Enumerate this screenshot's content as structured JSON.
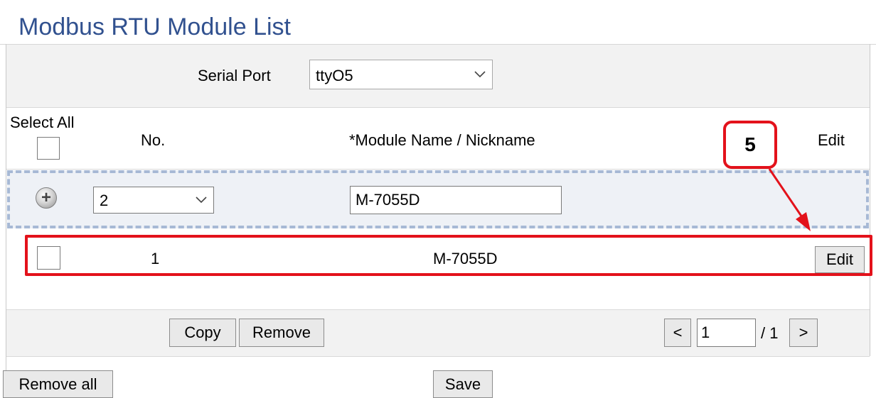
{
  "page": {
    "title": "Modbus RTU Module List"
  },
  "serial_port": {
    "label": "Serial Port",
    "selected": "ttyO5"
  },
  "table_header": {
    "select_all": "Select All",
    "no": "No.",
    "module_name": "*Module Name / Nickname",
    "edit": "Edit"
  },
  "add_row": {
    "no_selected": "2",
    "name_value": "M-7055D"
  },
  "rows": [
    {
      "no": "1",
      "name": "M-7055D",
      "edit_label": "Edit"
    }
  ],
  "actions": {
    "copy": "Copy",
    "remove": "Remove",
    "remove_all": "Remove all",
    "save": "Save"
  },
  "pager": {
    "prev": "<",
    "next": ">",
    "current": "1",
    "total": "/ 1"
  },
  "annotation": {
    "label": "5",
    "color": "#e3121b"
  },
  "colors": {
    "title": "#31518f",
    "highlight": "#e3121b",
    "dashed_border": "#a7b9d5"
  }
}
